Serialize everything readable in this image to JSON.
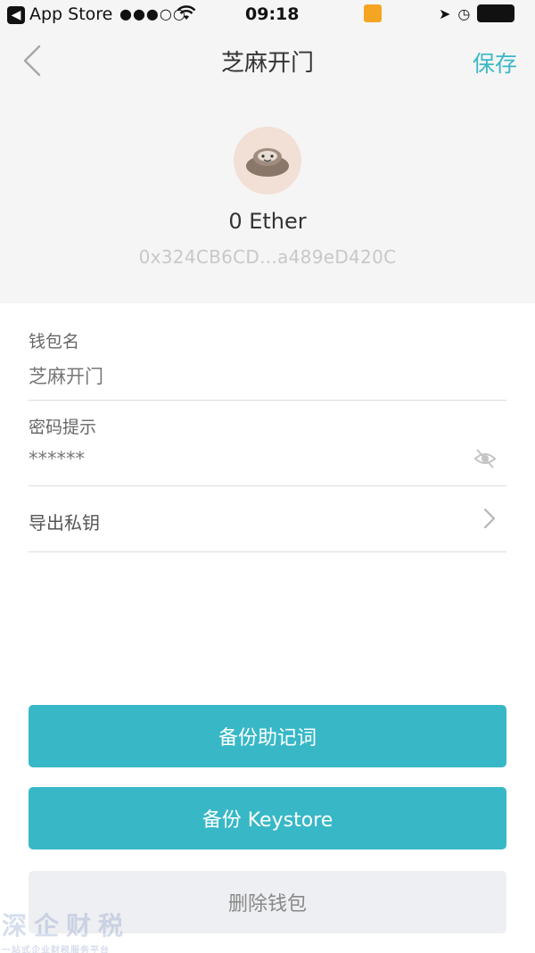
{
  "status_bar": {
    "back_app_label": "App Store",
    "signal": "●●●○○",
    "time": "09:18"
  },
  "nav": {
    "title": "芝麻开门",
    "save_label": "保存"
  },
  "wallet": {
    "balance": "0 Ether",
    "address": "0x324CB6CD...a489eD420C"
  },
  "form": {
    "name_label": "钱包名",
    "name_value": "芝麻开门",
    "hint_label": "密码提示",
    "hint_value": "******",
    "export_label": "导出私钥"
  },
  "actions": {
    "backup_mnemonic": "备份助记词",
    "backup_keystore": "备份 Keystore",
    "delete_wallet": "删除钱包"
  },
  "colors": {
    "accent": "#38b8c7",
    "header_bg": "#f5f5f5"
  }
}
